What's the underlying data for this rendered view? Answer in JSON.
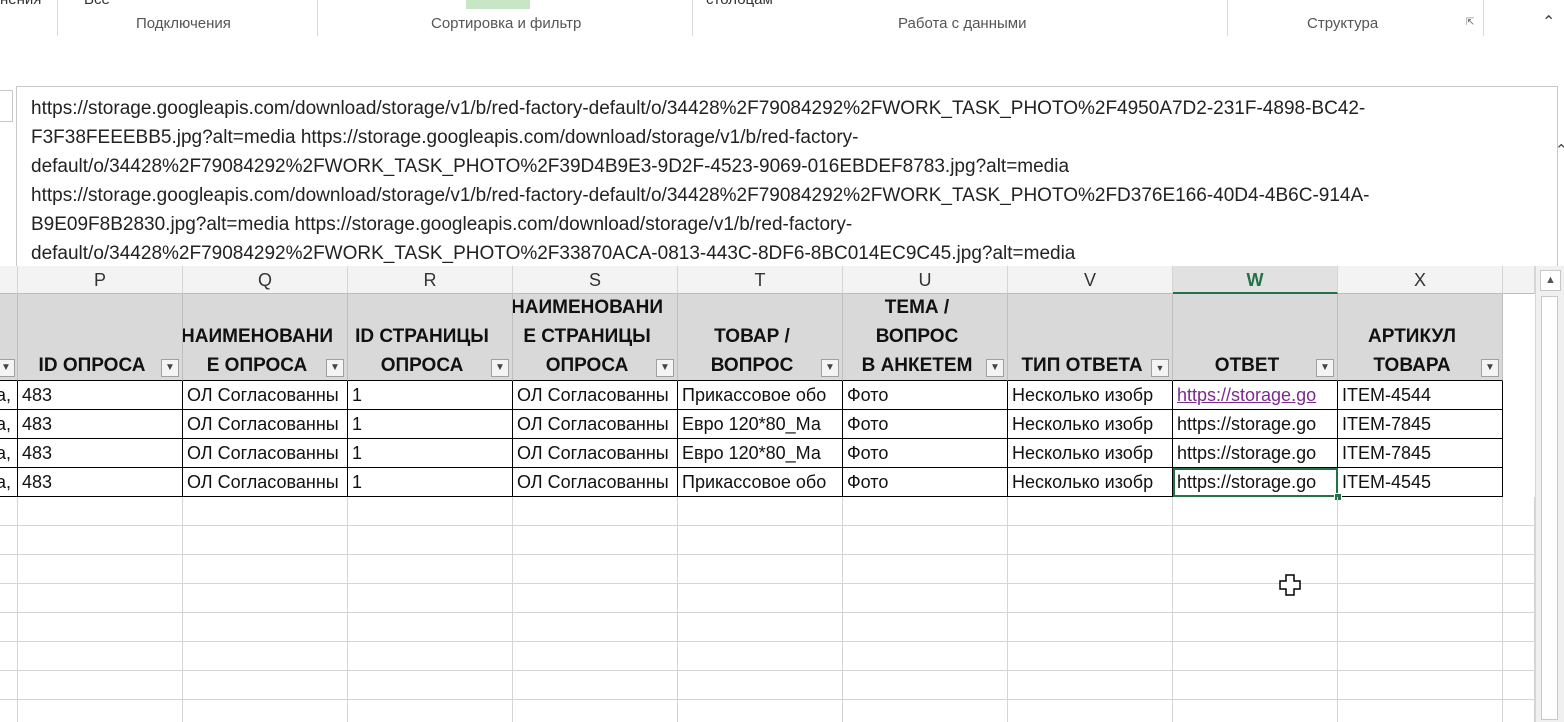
{
  "ribbon": {
    "clipped_left": "нения",
    "clipped_all": "Все",
    "clipped_mid": "столбцам",
    "groups": [
      "Подключения",
      "Сортировка и фильтр",
      "Работа с данными",
      "Структура"
    ]
  },
  "formula_bar": {
    "lines": [
      "https://storage.googleapis.com/download/storage/v1/b/red-factory-default/o/34428%2F79084292%2FWORK_TASK_PHOTO%2F4950A7D2-231F-4898-BC42-",
      "F3F38FEEEBB5.jpg?alt=media https://storage.googleapis.com/download/storage/v1/b/red-factory-",
      "default/o/34428%2F79084292%2FWORK_TASK_PHOTO%2F39D4B9E3-9D2F-4523-9069-016EBDEF8783.jpg?alt=media",
      "https://storage.googleapis.com/download/storage/v1/b/red-factory-default/o/34428%2F79084292%2FWORK_TASK_PHOTO%2FD376E166-40D4-4B6C-914A-",
      "B9E09F8B2830.jpg?alt=media https://storage.googleapis.com/download/storage/v1/b/red-factory-",
      "default/o/34428%2F79084292%2FWORK_TASK_PHOTO%2F33870ACA-0813-443C-8DF6-8BC014EC9C45.jpg?alt=media"
    ]
  },
  "columns": [
    "P",
    "Q",
    "R",
    "S",
    "T",
    "U",
    "V",
    "W",
    "X"
  ],
  "selected_column": "W",
  "headers": [
    "ID ОПРОСА",
    "НАИМЕНОВАНИ\nЕ ОПРОСА",
    "ID СТРАНИЦЫ\nОПРОСА",
    "НАИМЕНОВАНИ\nЕ СТРАНИЦЫ\nОПРОСА",
    "ТОВАР /\nВОПРОС",
    "ТЕМА /ВОПРОС\nВ АНКЕТЕМ",
    "ТИП ОТВЕТА",
    "ОТВЕТ",
    "АРТИКУЛ\nТОВАРА"
  ],
  "filter_active_index": 6,
  "rows": [
    {
      "lead": "а,",
      "cells": [
        "483",
        "ОЛ Согласованны",
        "1",
        "ОЛ Согласованны",
        "Прикассовое обо",
        "Фото",
        "Несколько изобр",
        "https://storage.go",
        "ITEM-4544"
      ]
    },
    {
      "lead": "а,",
      "cells": [
        "483",
        "ОЛ Согласованны",
        "1",
        "ОЛ Согласованны",
        "Евро 120*80_Ма",
        "Фото",
        "Несколько изобр",
        "https://storage.go",
        "ITEM-7845"
      ]
    },
    {
      "lead": "а,",
      "cells": [
        "483",
        "ОЛ Согласованны",
        "1",
        "ОЛ Согласованны",
        "Евро 120*80_Ма",
        "Фото",
        "Несколько изобр",
        "https://storage.go",
        "ITEM-7845"
      ]
    },
    {
      "lead": "а,",
      "cells": [
        "483",
        "ОЛ Согласованны",
        "1",
        "ОЛ Согласованны",
        "Прикассовое обо",
        "Фото",
        "Несколько изобр",
        "https://storage.go",
        "ITEM-4545"
      ]
    }
  ]
}
